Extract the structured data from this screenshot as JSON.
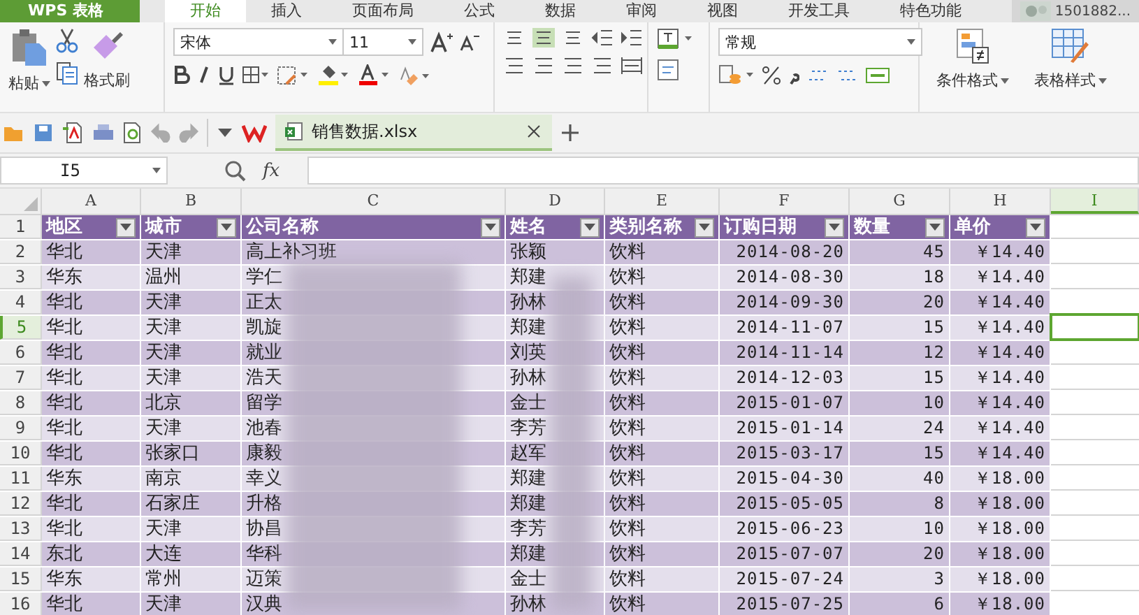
{
  "app": {
    "title": "WPS 表格"
  },
  "tabs": [
    {
      "label": "开始",
      "selected": true
    },
    {
      "label": "插入",
      "selected": false
    },
    {
      "label": "页面布局",
      "selected": false
    },
    {
      "label": "公式",
      "selected": false
    },
    {
      "label": "数据",
      "selected": false
    },
    {
      "label": "审阅",
      "selected": false
    },
    {
      "label": "视图",
      "selected": false
    },
    {
      "label": "开发工具",
      "selected": false
    },
    {
      "label": "特色功能",
      "selected": false
    }
  ],
  "account": {
    "name": "1501882..."
  },
  "ribbon": {
    "paste": "粘贴",
    "format_painter": "格式刷",
    "font_name": "宋体",
    "font_size": "11",
    "number_format": "常规",
    "conditional_format": "条件格式",
    "table_style": "表格样式"
  },
  "document_tabs": [
    {
      "label": "销售数据.xlsx",
      "selected": true
    }
  ],
  "formula_bar": {
    "cell_ref": "I5",
    "function_label": "fx"
  },
  "sheet": {
    "columns": [
      {
        "label": "A",
        "selected": false
      },
      {
        "label": "B",
        "selected": false
      },
      {
        "label": "C",
        "selected": false
      },
      {
        "label": "D",
        "selected": false
      },
      {
        "label": "E",
        "selected": false
      },
      {
        "label": "F",
        "selected": false
      },
      {
        "label": "G",
        "selected": false
      },
      {
        "label": "H",
        "selected": false
      },
      {
        "label": "I",
        "selected": true
      }
    ],
    "rows": [
      {
        "number": "1",
        "selected": false,
        "kind": "header",
        "cells": [
          "地区",
          "城市",
          "公司名称",
          "姓名",
          "类别名称",
          "订购日期",
          "数量",
          "单价"
        ]
      },
      {
        "number": "2",
        "selected": false,
        "kind": "data",
        "cells": [
          "华北",
          "天津",
          "高上补习班",
          "张颖",
          "饮料",
          "2014-08-20",
          "45",
          "￥14.40"
        ]
      },
      {
        "number": "3",
        "selected": false,
        "kind": "data",
        "cells": [
          "华东",
          "温州",
          "学仁",
          "郑建",
          "饮料",
          "2014-08-30",
          "18",
          "￥14.40"
        ]
      },
      {
        "number": "4",
        "selected": false,
        "kind": "data",
        "cells": [
          "华北",
          "天津",
          "正太",
          "孙林",
          "饮料",
          "2014-09-30",
          "20",
          "￥14.40"
        ]
      },
      {
        "number": "5",
        "selected": true,
        "kind": "data",
        "cells": [
          "华北",
          "天津",
          "凯旋",
          "郑建",
          "饮料",
          "2014-11-07",
          "15",
          "￥14.40"
        ]
      },
      {
        "number": "6",
        "selected": false,
        "kind": "data",
        "cells": [
          "华北",
          "天津",
          "就业",
          "刘英",
          "饮料",
          "2014-11-14",
          "12",
          "￥14.40"
        ]
      },
      {
        "number": "7",
        "selected": false,
        "kind": "data",
        "cells": [
          "华北",
          "天津",
          "浩天",
          "孙林",
          "饮料",
          "2014-12-03",
          "15",
          "￥14.40"
        ]
      },
      {
        "number": "8",
        "selected": false,
        "kind": "data",
        "cells": [
          "华北",
          "北京",
          "留学",
          "金士",
          "饮料",
          "2015-01-07",
          "10",
          "￥14.40"
        ]
      },
      {
        "number": "9",
        "selected": false,
        "kind": "data",
        "cells": [
          "华北",
          "天津",
          "池春",
          "李芳",
          "饮料",
          "2015-01-14",
          "24",
          "￥14.40"
        ]
      },
      {
        "number": "10",
        "selected": false,
        "kind": "data",
        "cells": [
          "华北",
          "张家口",
          "康毅",
          "赵军",
          "饮料",
          "2015-03-17",
          "15",
          "￥14.40"
        ]
      },
      {
        "number": "11",
        "selected": false,
        "kind": "data",
        "cells": [
          "华东",
          "南京",
          "幸义",
          "郑建",
          "饮料",
          "2015-04-30",
          "40",
          "￥18.00"
        ]
      },
      {
        "number": "12",
        "selected": false,
        "kind": "data",
        "cells": [
          "华北",
          "石家庄",
          "升格",
          "郑建",
          "饮料",
          "2015-05-05",
          "8",
          "￥18.00"
        ]
      },
      {
        "number": "13",
        "selected": false,
        "kind": "data",
        "cells": [
          "华北",
          "天津",
          "协昌",
          "李芳",
          "饮料",
          "2015-06-23",
          "10",
          "￥18.00"
        ]
      },
      {
        "number": "14",
        "selected": false,
        "kind": "data",
        "cells": [
          "东北",
          "大连",
          "华科",
          "郑建",
          "饮料",
          "2015-07-07",
          "20",
          "￥18.00"
        ]
      },
      {
        "number": "15",
        "selected": false,
        "kind": "data",
        "cells": [
          "华东",
          "常州",
          "迈策",
          "金士",
          "饮料",
          "2015-07-24",
          "3",
          "￥18.00"
        ]
      },
      {
        "number": "16",
        "selected": false,
        "kind": "data",
        "cells": [
          "华北",
          "天津",
          "汉典",
          "孙林",
          "饮料",
          "2015-07-25",
          "6",
          "￥18.00"
        ]
      }
    ]
  }
}
